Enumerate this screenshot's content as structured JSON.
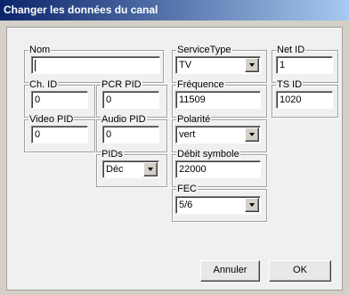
{
  "window": {
    "title": "Changer les données du canal"
  },
  "fields": {
    "nom": {
      "label": "Nom",
      "value": ""
    },
    "service_type": {
      "label": "ServiceType",
      "value": "TV"
    },
    "net_id": {
      "label": "Net ID",
      "value": "1"
    },
    "ch_id": {
      "label": "Ch. ID",
      "value": "0"
    },
    "pcr_pid": {
      "label": "PCR PID",
      "value": "0"
    },
    "frequence": {
      "label": "Fréquence",
      "value": "11509"
    },
    "ts_id": {
      "label": "TS ID",
      "value": "1020"
    },
    "video_pid": {
      "label": "Video PID",
      "value": "0"
    },
    "audio_pid": {
      "label": "Audio PID",
      "value": "0"
    },
    "polarite": {
      "label": "Polarité",
      "value": "vert"
    },
    "pids": {
      "label": "PIDs",
      "value": "Déc"
    },
    "debit_symbole": {
      "label": "Débit symbole",
      "value": "22000"
    },
    "fec": {
      "label": "FEC",
      "value": "5/6"
    }
  },
  "buttons": {
    "cancel": "Annuler",
    "ok": "OK"
  },
  "colors": {
    "titlebar_start": "#0a246a",
    "titlebar_end": "#a6caf0",
    "panel": "#f0f0f0"
  }
}
